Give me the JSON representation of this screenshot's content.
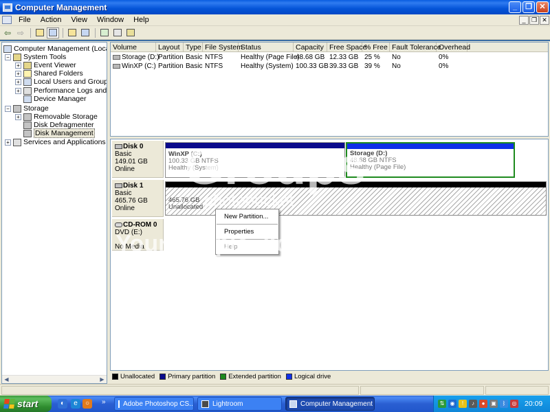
{
  "window": {
    "title": "Computer Management",
    "controls": {
      "minimize": "_",
      "maximize": "❐",
      "close": "✕"
    }
  },
  "menu": {
    "items": [
      "File",
      "Action",
      "View",
      "Window",
      "Help"
    ],
    "mdi_controls": {
      "minimize": "_",
      "restore": "❐",
      "close": "✕"
    }
  },
  "toolbar": {
    "icons": [
      "back-icon",
      "forward-icon",
      "up-folder-icon",
      "show-hide-tree-icon",
      "properties-icon",
      "export-list-icon",
      "refresh-icon",
      "help-icon",
      "console-icon"
    ]
  },
  "tree": {
    "root": "Computer Management (Local)",
    "system_tools": "System Tools",
    "event_viewer": "Event Viewer",
    "shared_folders": "Shared Folders",
    "local_users": "Local Users and Groups",
    "perf_logs": "Performance Logs and Alerts",
    "device_manager": "Device Manager",
    "storage": "Storage",
    "removable_storage": "Removable Storage",
    "disk_defrag": "Disk Defragmenter",
    "disk_management": "Disk Management",
    "services": "Services and Applications"
  },
  "volumes": {
    "columns": [
      "Volume",
      "Layout",
      "Type",
      "File System",
      "Status",
      "Capacity",
      "Free Space",
      "% Free",
      "Fault Tolerance",
      "Overhead"
    ],
    "rows": [
      [
        "Storage (D:)",
        "Partition",
        "Basic",
        "NTFS",
        "Healthy (Page File)",
        "48.68 GB",
        "12.33 GB",
        "25 %",
        "No",
        "0%"
      ],
      [
        "WinXP (C:)",
        "Partition",
        "Basic",
        "NTFS",
        "Healthy (System)",
        "100.33 GB",
        "39.33 GB",
        "39 %",
        "No",
        "0%"
      ]
    ]
  },
  "disks": {
    "disk0": {
      "name": "Disk 0",
      "type": "Basic",
      "size": "149.01 GB",
      "state": "Online",
      "part1": {
        "name": "WinXP  (C:)",
        "detail": "100.33 GB NTFS",
        "status": "Healthy (System)"
      },
      "part2": {
        "name": "Storage  (D:)",
        "detail": "48.68 GB NTFS",
        "status": "Healthy (Page File)"
      }
    },
    "disk1": {
      "name": "Disk 1",
      "type": "Basic",
      "size": "465.76 GB",
      "state": "Online",
      "part1": {
        "detail": "465.76 GB",
        "status": "Unallocated"
      }
    },
    "cdrom0": {
      "name": "CD-ROM 0",
      "type": "DVD (E:)",
      "state": "No Media"
    }
  },
  "context_menu": {
    "new_partition": "New Partition...",
    "properties": "Properties",
    "help": "Help"
  },
  "legend": [
    {
      "label": "Unallocated",
      "color": "#000000"
    },
    {
      "label": "Primary partition",
      "color": "#0a0a8c"
    },
    {
      "label": "Extended partition",
      "color": "#1d8a1d"
    },
    {
      "label": "Logical drive",
      "color": "#1030e8"
    }
  ],
  "watermark": {
    "logo": "Groups",
    "brand": "photobucket",
    "line1": "Your people. Your moments.",
    "line2": "Your space."
  },
  "taskbar": {
    "start_label": "start",
    "overflow": "»",
    "tasks": [
      {
        "label": "Adobe Photoshop CS...",
        "icon_color": "#1a2c6e"
      },
      {
        "label": "Lightroom",
        "icon_color": "#4a4a4a"
      },
      {
        "label": "Computer Management",
        "icon_color": "#c9d8f0"
      }
    ],
    "clock": "20:09"
  }
}
